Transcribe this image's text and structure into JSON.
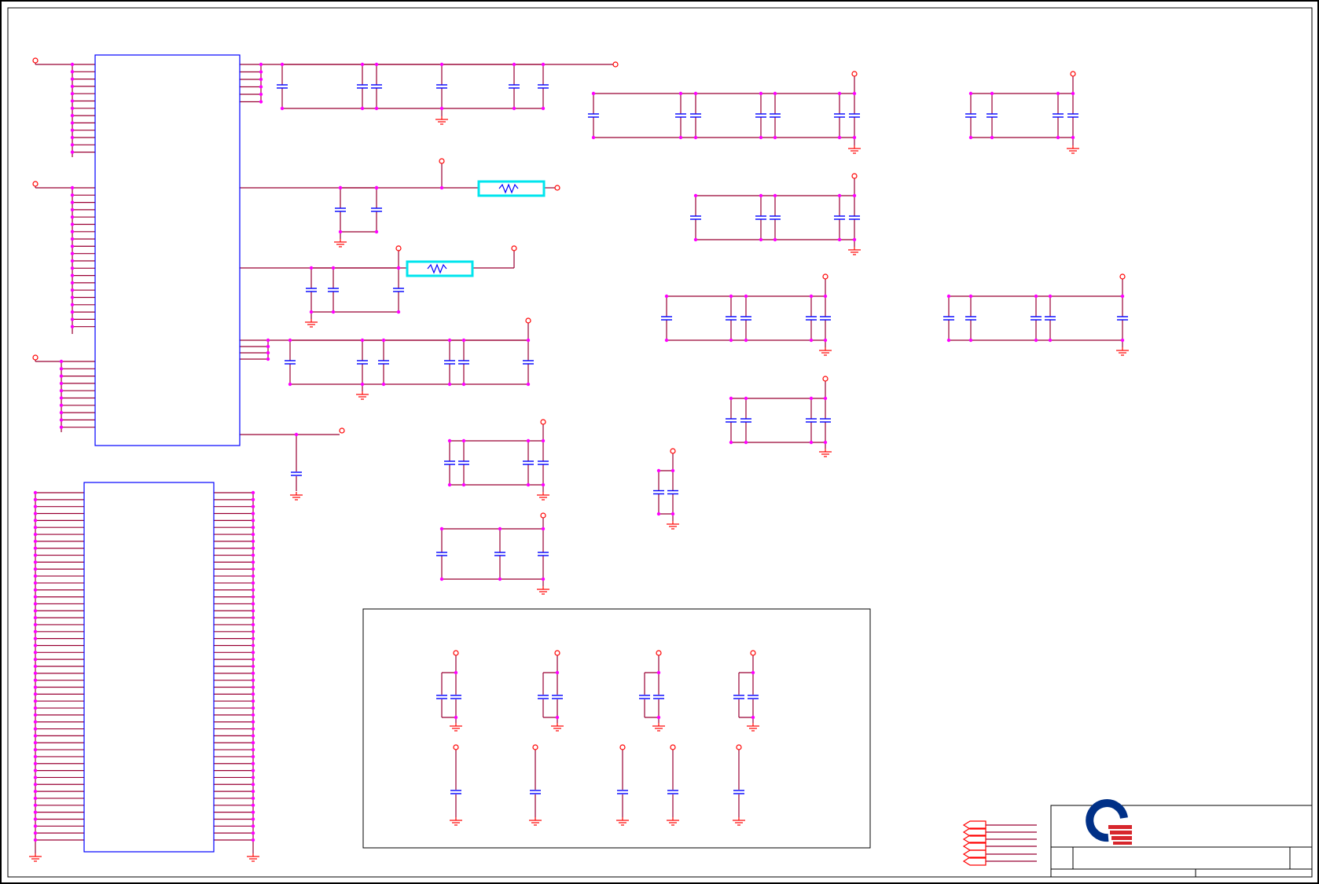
{
  "sheet": {
    "title_block": {
      "logo": "quanta-logo",
      "title": "",
      "sheet_info": ""
    }
  },
  "colors": {
    "wire": "#990033",
    "power_ground": "#ff0000",
    "component": "#0000ff",
    "junction": "#ff00ff",
    "highlight": "#00e5ee",
    "border": "#000000",
    "logo_blue": "#003087",
    "logo_red": "#d7262c"
  },
  "components": {
    "ic_upper": "ic-upper",
    "ic_lower": "ic-lower",
    "resistors": [
      "resistor-1",
      "resistor-2"
    ],
    "capacitor_icon": "capacitor-icon",
    "ground_icon": "ground-icon",
    "power_icon": "power-pin-icon",
    "offpage_connector_icon": "offpage-connector-icon"
  }
}
